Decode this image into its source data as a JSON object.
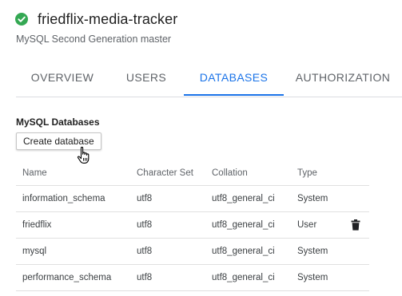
{
  "instance": {
    "name": "friedflix-media-tracker",
    "subtitle": "MySQL Second Generation master",
    "status_color": "#34a853"
  },
  "tabs": [
    {
      "label": "OVERVIEW",
      "active": false
    },
    {
      "label": "USERS",
      "active": false
    },
    {
      "label": "DATABASES",
      "active": true
    },
    {
      "label": "AUTHORIZATION",
      "active": false
    }
  ],
  "accent_color": "#1a73e8",
  "databases": {
    "heading": "MySQL Databases",
    "create_label": "Create database",
    "columns": [
      "Name",
      "Character Set",
      "Collation",
      "Type"
    ],
    "rows": [
      {
        "name": "information_schema",
        "charset": "utf8",
        "collation": "utf8_general_ci",
        "type": "System",
        "deletable": false
      },
      {
        "name": "friedflix",
        "charset": "utf8",
        "collation": "utf8_general_ci",
        "type": "User",
        "deletable": true
      },
      {
        "name": "mysql",
        "charset": "utf8",
        "collation": "utf8_general_ci",
        "type": "System",
        "deletable": false
      },
      {
        "name": "performance_schema",
        "charset": "utf8",
        "collation": "utf8_general_ci",
        "type": "System",
        "deletable": false
      }
    ]
  },
  "icons": {
    "status": "check-circle-icon",
    "delete": "trash-icon",
    "cursor": "hand-pointer-icon"
  }
}
